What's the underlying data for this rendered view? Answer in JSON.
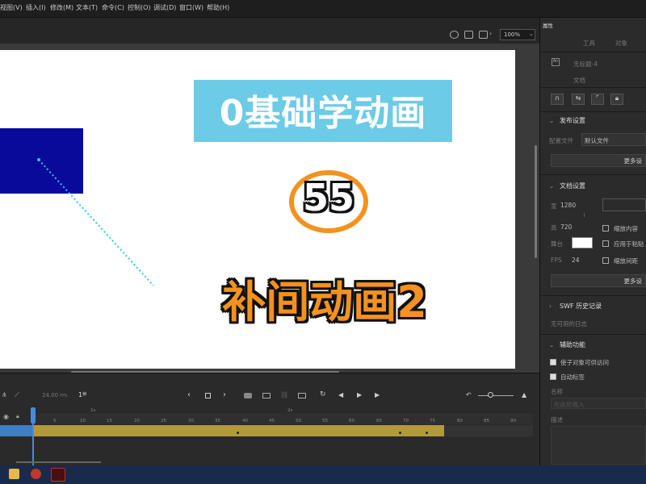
{
  "menu": [
    "视图(V)",
    "插入(I)",
    "修改(M)",
    "文本(T)",
    "命令(C)",
    "控制(O)",
    "调试(D)",
    "窗口(W)",
    "帮助(H)"
  ],
  "toolbar": {
    "zoom": "100%"
  },
  "stage": {
    "title": "0基础学动画",
    "number": "55",
    "subtitle": "补间动画2",
    "colors": {
      "title_box": "#6ccbe6",
      "accent": "#f39220",
      "rect": "#0a0a9a"
    }
  },
  "panel": {
    "tabs": [
      "属性",
      "工具",
      "对象"
    ],
    "doc_name": "无标题-4",
    "doc_type": "文档",
    "publish": {
      "header": "发布设置",
      "profile_label": "配置文件",
      "profile_value": "默认文件",
      "more": "更多设"
    },
    "doc_settings": {
      "header": "文档设置",
      "width_label": "宽",
      "width": "1280",
      "height_label": "高",
      "height": "720",
      "stage_label": "舞台",
      "fps_label": "FPS",
      "fps": "24",
      "scale_content": "缩放内容",
      "apply_paste": "应用于粘贴",
      "scale_spacing": "缩放间距",
      "more": "更多设"
    },
    "swf": {
      "header": "SWF 历史记录",
      "empty": "无可用的日志"
    },
    "accessibility": {
      "header": "辅助功能",
      "make_accessible": "使子对象可供访问",
      "auto_label": "自动标签",
      "name_label": "名称",
      "name_placeholder": "在此处输入",
      "desc_label": "描述"
    }
  },
  "timeline": {
    "fps": "24.00",
    "fps_unit": "FPS",
    "frame": "1",
    "frame_unit": "帧",
    "ticks": [
      "1s",
      "2s",
      "5",
      "10",
      "15",
      "20",
      "25",
      "30",
      "35",
      "40",
      "45",
      "50",
      "55",
      "60",
      "65",
      "70",
      "75",
      "80",
      "85",
      "90"
    ]
  }
}
